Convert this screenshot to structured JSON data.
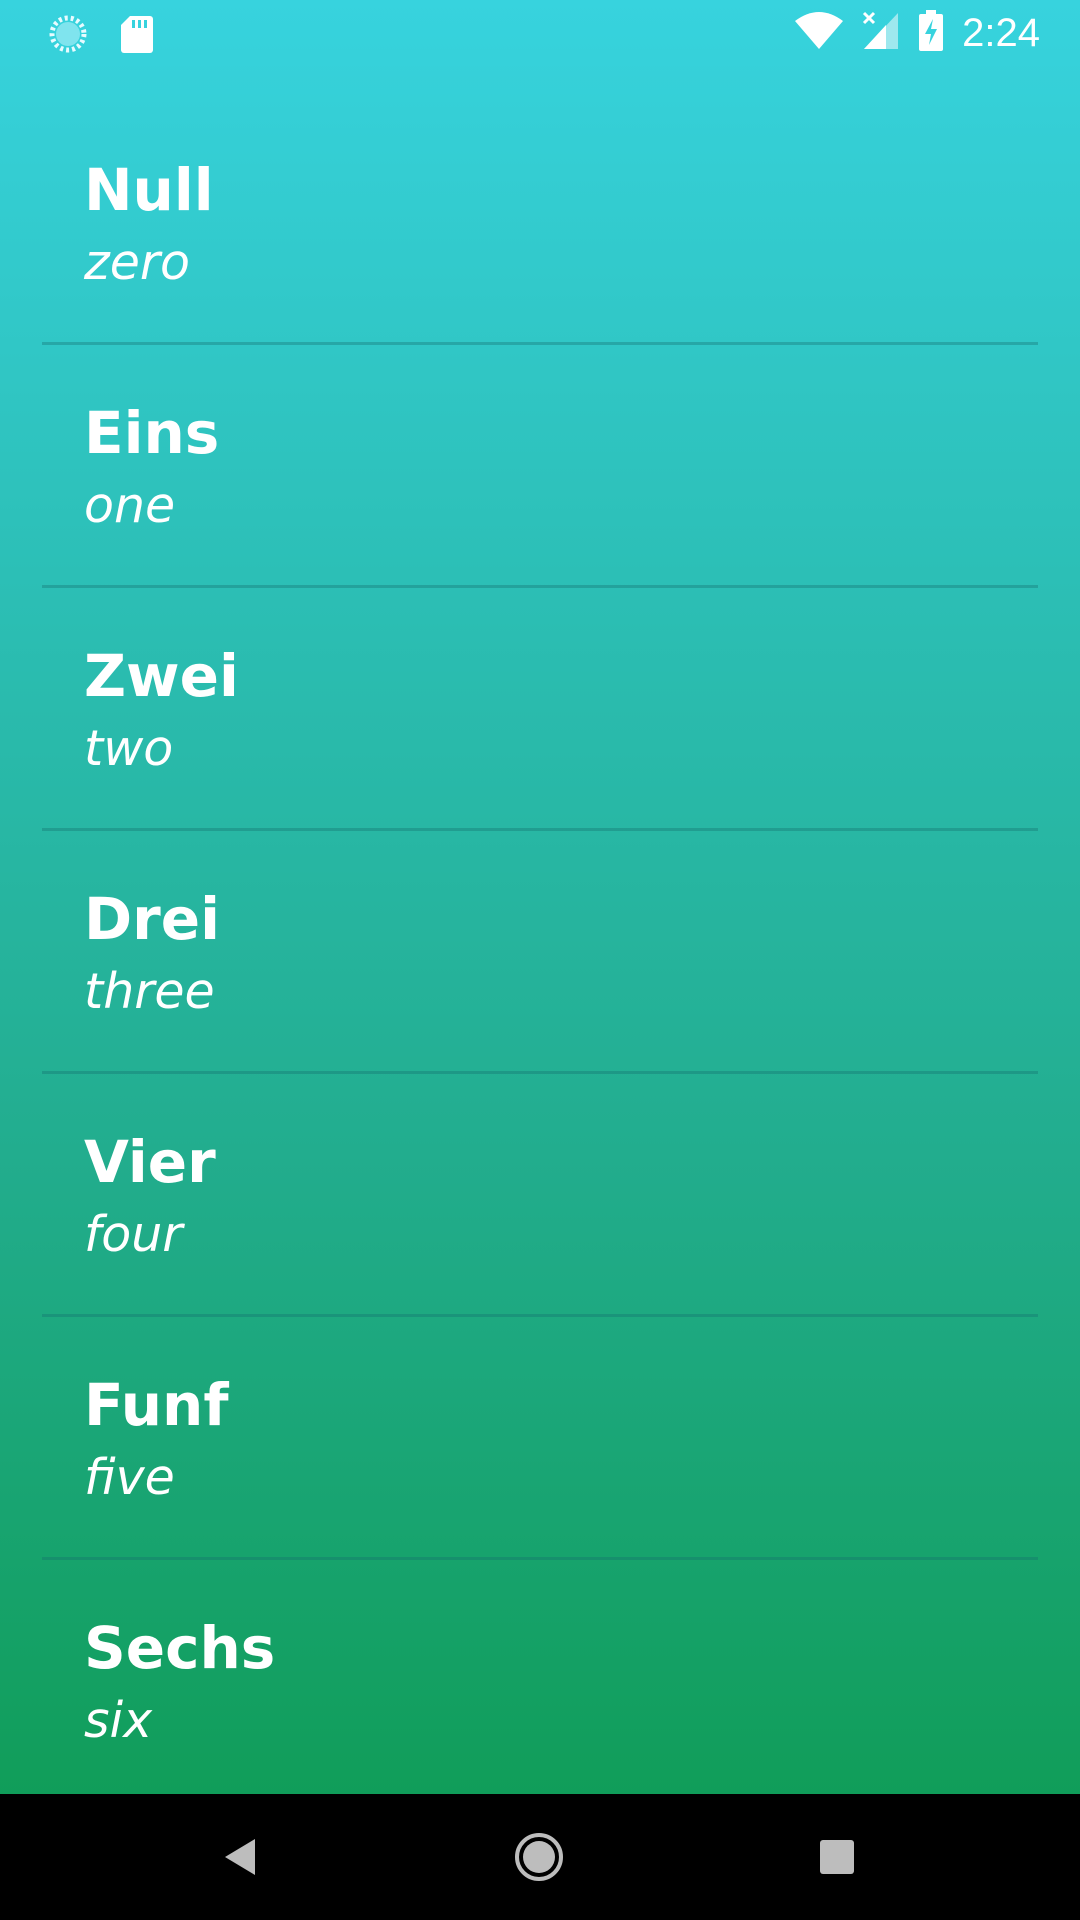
{
  "status_bar": {
    "time": "2:24",
    "left_icons": [
      "sync-icon",
      "sd-card-icon"
    ],
    "right_icons": [
      "wifi-icon",
      "cell-signal-icon",
      "battery-charging-icon"
    ]
  },
  "colors": {
    "gradient_top": "#37d3de",
    "gradient_bottom": "#0d9a4f",
    "text": "#ffffff",
    "navbar": "#000000"
  },
  "numbers": [
    {
      "german": "Null",
      "english": "zero"
    },
    {
      "german": "Eins",
      "english": "one"
    },
    {
      "german": "Zwei",
      "english": "two"
    },
    {
      "german": "Drei",
      "english": "three"
    },
    {
      "german": "Vier",
      "english": "four"
    },
    {
      "german": "Funf",
      "english": "five"
    },
    {
      "german": "Sechs",
      "english": "six"
    }
  ],
  "nav_bar": {
    "buttons": [
      "back-icon",
      "home-icon",
      "recents-icon"
    ]
  }
}
